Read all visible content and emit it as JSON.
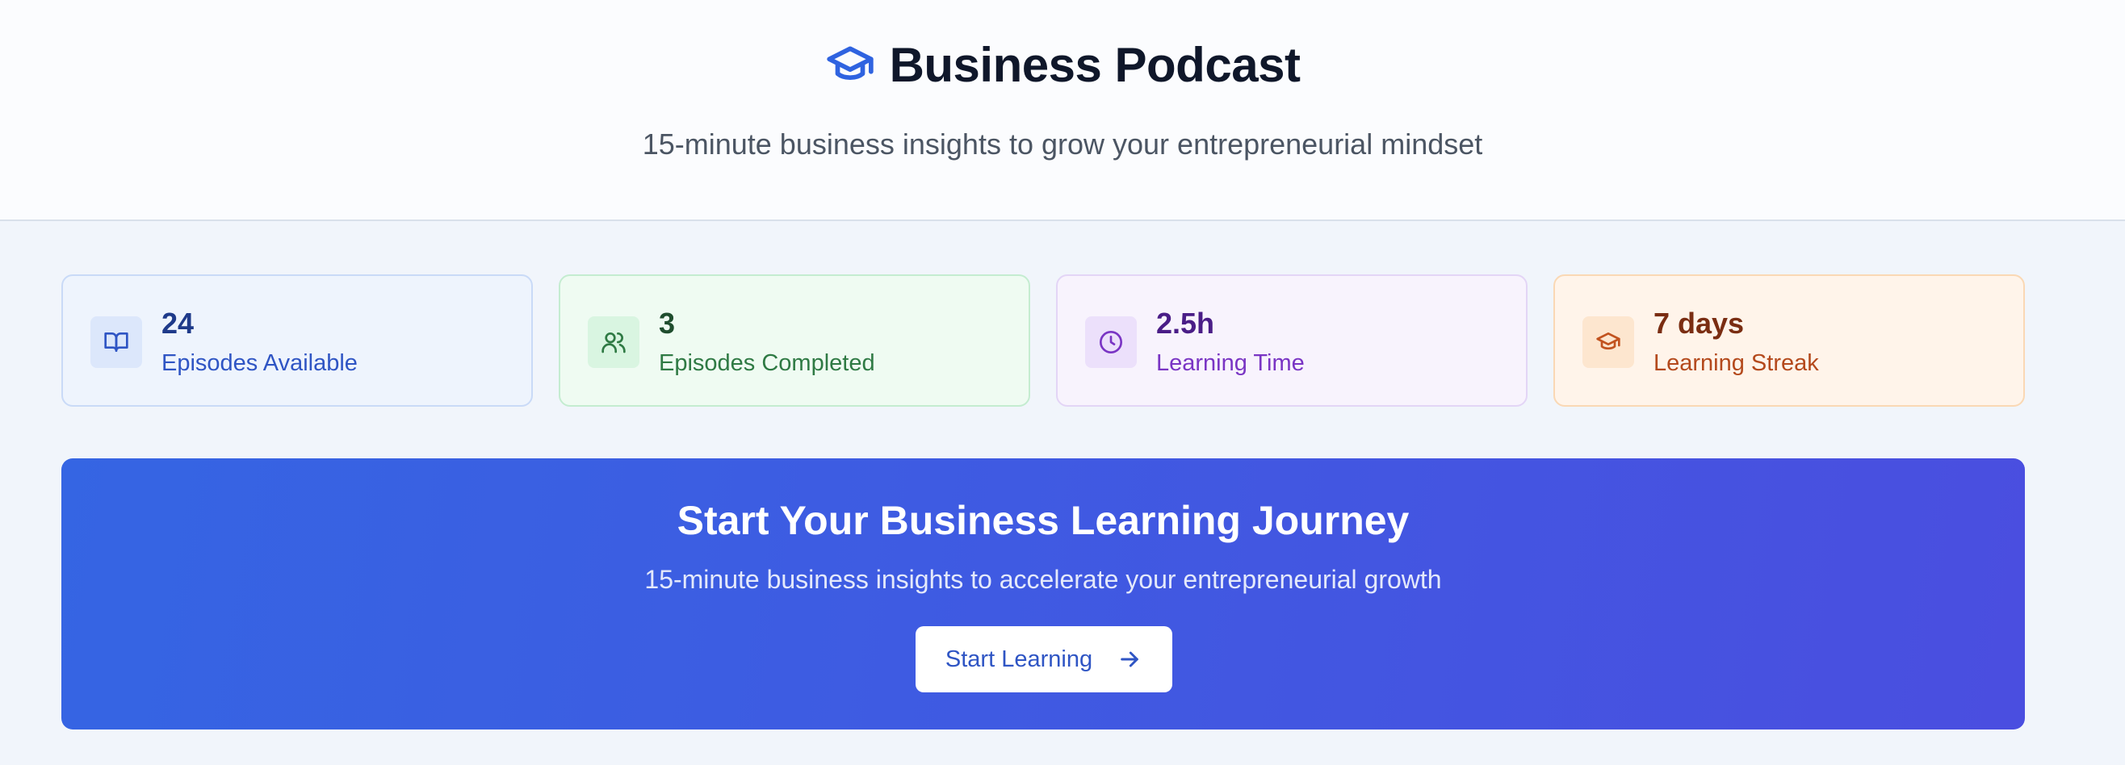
{
  "header": {
    "title": "Business Podcast",
    "subtitle": "15-minute business insights to grow your entrepreneurial mindset",
    "icon": "graduation-cap-icon"
  },
  "stats": [
    {
      "value": "24",
      "label": "Episodes Available",
      "icon": "book-open-icon",
      "color": "#2f55c4"
    },
    {
      "value": "3",
      "label": "Episodes Completed",
      "icon": "users-icon",
      "color": "#2f7a44"
    },
    {
      "value": "2.5h",
      "label": "Learning Time",
      "icon": "clock-icon",
      "color": "#7a35c4"
    },
    {
      "value": "7 days",
      "label": "Learning Streak",
      "icon": "graduation-cap-icon",
      "color": "#b4491c"
    }
  ],
  "hero": {
    "title": "Start Your Business Learning Journey",
    "subtitle": "15-minute business insights to accelerate your entrepreneurial growth",
    "button_label": "Start Learning",
    "button_icon": "arrow-right-icon"
  },
  "colors": {
    "accent": "#3565e3",
    "hero_gradient_end": "#4a4ee0"
  }
}
